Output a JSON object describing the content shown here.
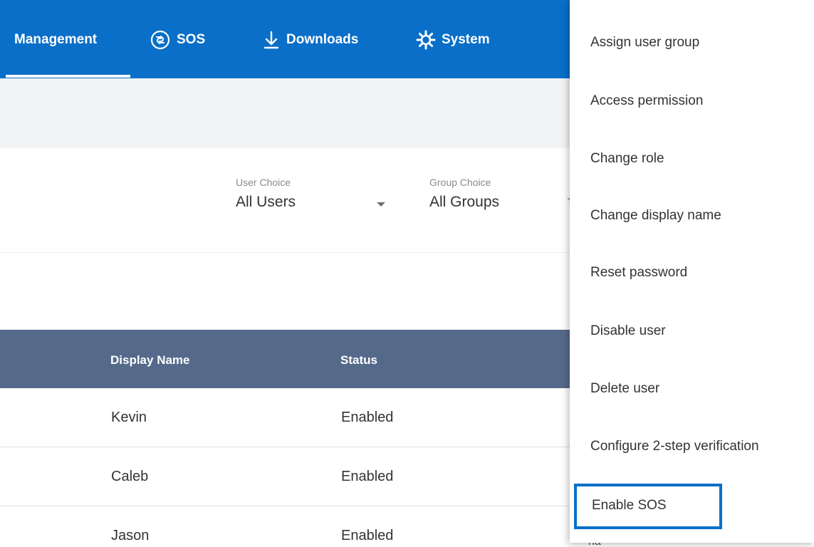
{
  "nav": {
    "items": [
      {
        "label": "Management",
        "icon": "none"
      },
      {
        "label": "SOS",
        "icon": "lifebuoy-icon"
      },
      {
        "label": "Downloads",
        "icon": "download-icon"
      },
      {
        "label": "System",
        "icon": "gear-icon"
      }
    ],
    "active": "Management",
    "color": "#0a6fc8"
  },
  "filters": {
    "user_choice": {
      "label": "User Choice",
      "value": "All Users"
    },
    "group_choice": {
      "label": "Group Choice",
      "value": "All Groups"
    }
  },
  "table": {
    "header_color": "#556a8a",
    "columns": [
      "Display Name",
      "Status"
    ],
    "rows": [
      {
        "display_name": "Kevin",
        "status": "Enabled"
      },
      {
        "display_name": "Caleb",
        "status": "Enabled"
      },
      {
        "display_name": "Jason",
        "status": "Enabled"
      }
    ]
  },
  "menu": {
    "items": [
      "Assign user group",
      "Access permission",
      "Change role",
      "Change display name",
      "Reset password",
      "Disable user",
      "Delete user",
      "Configure 2-step verification",
      "Enable SOS"
    ],
    "highlighted": "Enable SOS",
    "highlight_color": "#0a6fc8"
  },
  "partial_text": "на"
}
